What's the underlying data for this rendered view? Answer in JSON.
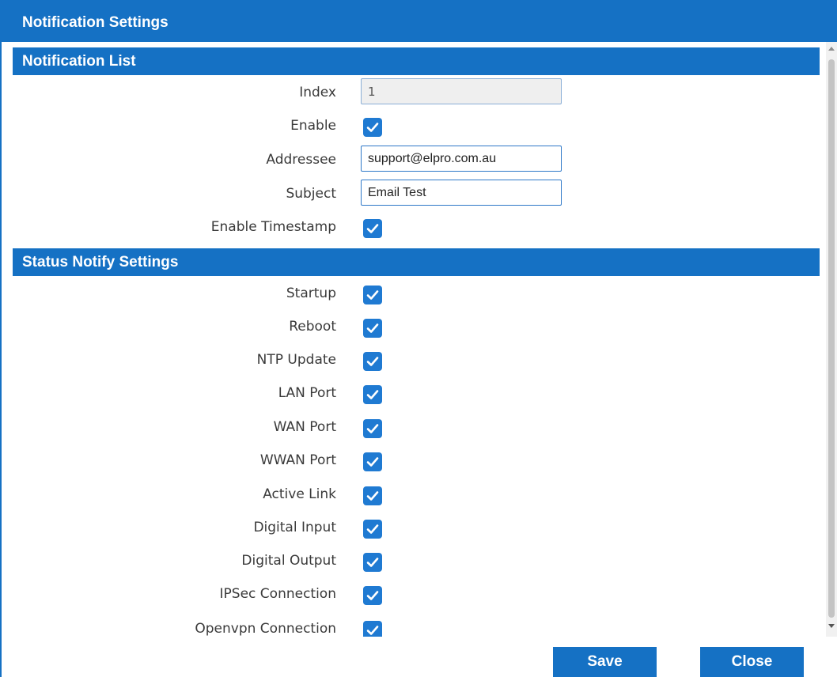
{
  "dialog": {
    "title": "Notification Settings"
  },
  "notification_list": {
    "header": "Notification List",
    "index": {
      "label": "Index",
      "value": "1"
    },
    "enable": {
      "label": "Enable",
      "checked": true
    },
    "addressee": {
      "label": "Addressee",
      "value": "support@elpro.com.au"
    },
    "subject": {
      "label": "Subject",
      "value": "Email Test"
    },
    "enable_timestamp": {
      "label": "Enable Timestamp",
      "checked": true
    }
  },
  "status_notify": {
    "header": "Status Notify Settings",
    "items": [
      {
        "label": "Startup",
        "checked": true
      },
      {
        "label": "Reboot",
        "checked": true
      },
      {
        "label": "NTP Update",
        "checked": true
      },
      {
        "label": "LAN Port",
        "checked": true
      },
      {
        "label": "WAN Port",
        "checked": true
      },
      {
        "label": "WWAN Port",
        "checked": true
      },
      {
        "label": "Active Link",
        "checked": true
      },
      {
        "label": "Digital Input",
        "checked": true
      },
      {
        "label": "Digital Output",
        "checked": true
      },
      {
        "label": "IPSec Connection",
        "checked": true
      },
      {
        "label": "Openvpn Connection",
        "checked": true
      }
    ]
  },
  "buttons": {
    "save": "Save",
    "close": "Close"
  },
  "colors": {
    "accent": "#1571c4",
    "checkbox": "#1f7ad2"
  }
}
